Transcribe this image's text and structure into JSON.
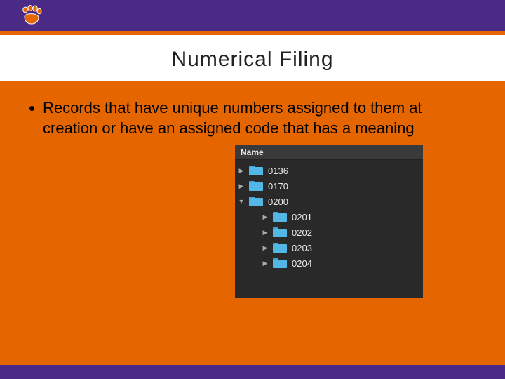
{
  "brand": {
    "paw_color": "#e56600",
    "header_bg": "#4a2a84",
    "accent": "#e56600"
  },
  "title": "Numerical Filing",
  "bullet": "Records that have unique numbers assigned to them at creation or have an assigned code that has a meaning",
  "finder": {
    "header": "Name",
    "items": [
      {
        "label": "0136",
        "expanded": false,
        "depth": 0
      },
      {
        "label": "0170",
        "expanded": false,
        "depth": 0
      },
      {
        "label": "0200",
        "expanded": true,
        "depth": 0
      },
      {
        "label": "0201",
        "expanded": false,
        "depth": 1
      },
      {
        "label": "0202",
        "expanded": false,
        "depth": 1
      },
      {
        "label": "0203",
        "expanded": false,
        "depth": 1
      },
      {
        "label": "0204",
        "expanded": false,
        "depth": 1
      }
    ]
  }
}
